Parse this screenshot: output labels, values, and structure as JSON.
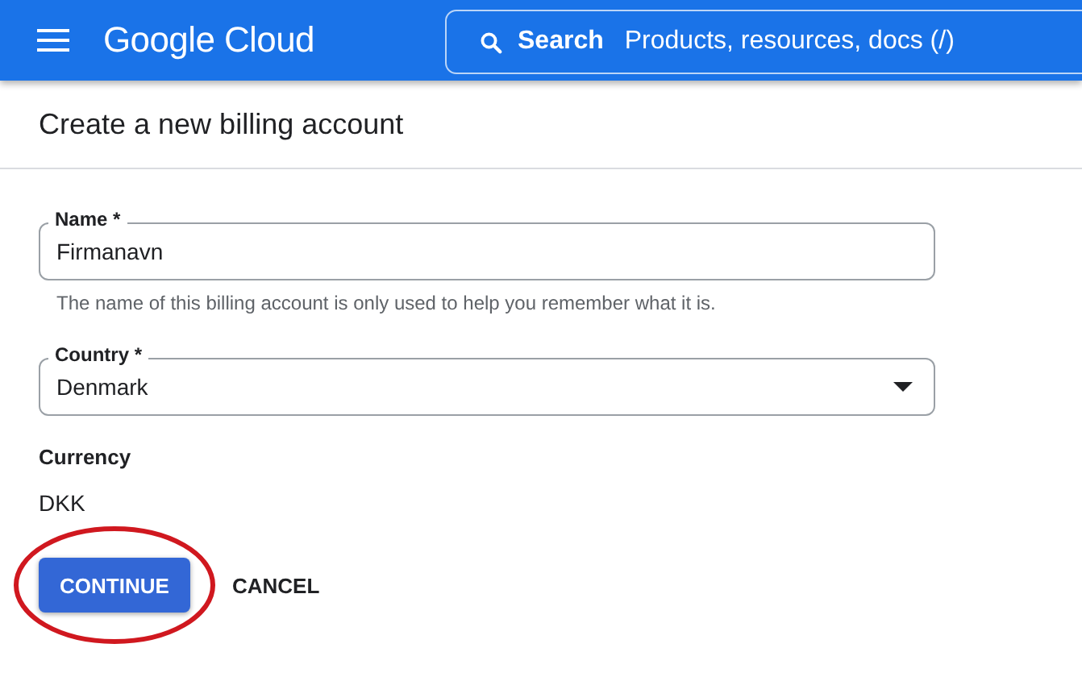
{
  "header": {
    "logo": "Google Cloud",
    "search": {
      "label": "Search",
      "placeholder": "Products, resources, docs (/)"
    }
  },
  "page_title": "Create a new billing account",
  "fields": [
    {
      "kind": "text",
      "label": "Name *",
      "value": "Firmanavn",
      "helper": "The name of this billing account is only used to help you remember what it is."
    },
    {
      "kind": "select",
      "label": "Country *",
      "value": "Denmark"
    }
  ],
  "currency": {
    "label": "Currency",
    "value": "DKK"
  },
  "buttons": [
    {
      "kind": "primary",
      "label": "CONTINUE",
      "highlighted": true
    },
    {
      "kind": "text",
      "label": "CANCEL",
      "highlighted": false
    }
  ]
}
